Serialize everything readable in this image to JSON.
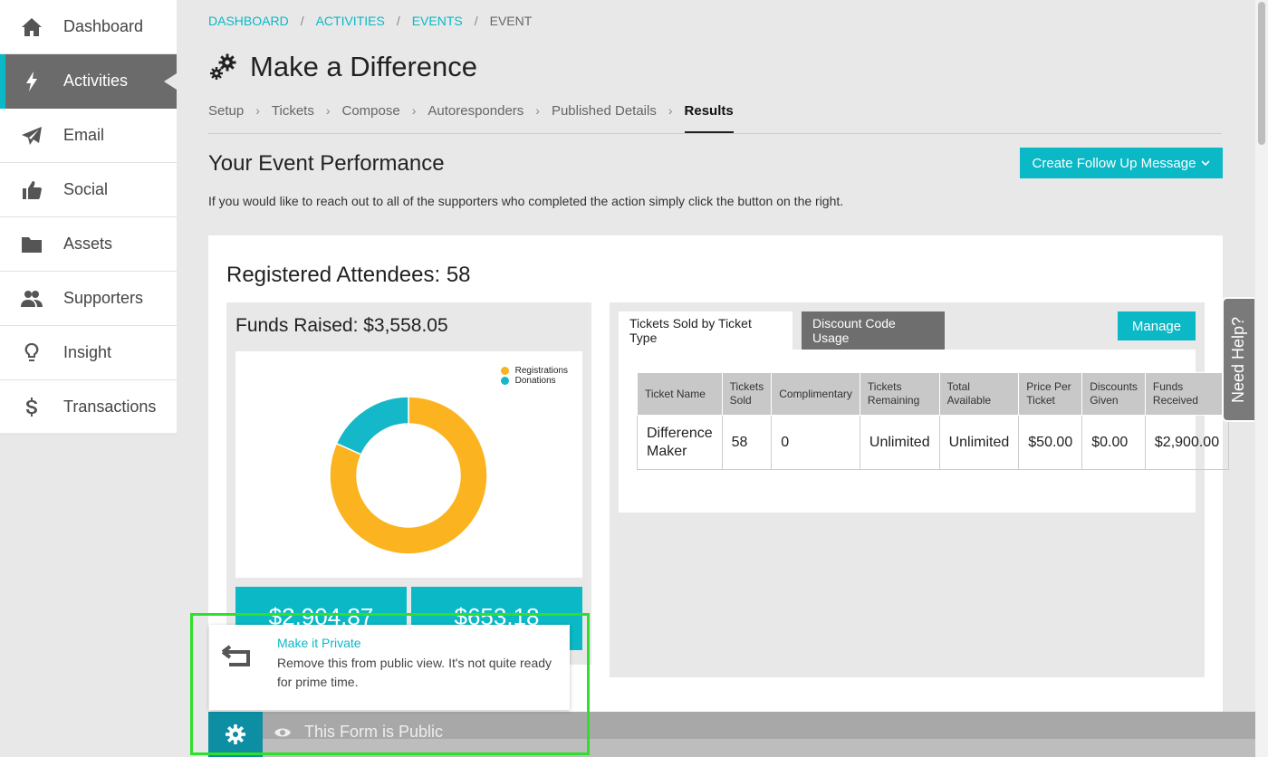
{
  "sidebar": {
    "items": [
      {
        "label": "Dashboard",
        "icon": "home-icon"
      },
      {
        "label": "Activities",
        "icon": "bolt-icon",
        "active": true
      },
      {
        "label": "Email",
        "icon": "paper-plane-icon"
      },
      {
        "label": "Social",
        "icon": "thumbs-up-icon"
      },
      {
        "label": "Assets",
        "icon": "folder-icon"
      },
      {
        "label": "Supporters",
        "icon": "users-icon"
      },
      {
        "label": "Insight",
        "icon": "lightbulb-icon"
      },
      {
        "label": "Transactions",
        "icon": "dollar-icon"
      }
    ]
  },
  "breadcrumb": [
    "DASHBOARD",
    "ACTIVITIES",
    "EVENTS",
    "EVENT"
  ],
  "page": {
    "title": "Make a Difference",
    "steps": [
      "Setup",
      "Tickets",
      "Compose",
      "Autoresponders",
      "Published Details",
      "Results"
    ],
    "active_step": "Results"
  },
  "performance": {
    "title": "Your Event Performance",
    "description": "If you would like to reach out to all of the supporters who completed the action simply click the button on the right.",
    "followup_button": "Create Follow Up Message"
  },
  "card": {
    "attendees_title": "Registered Attendees: 58",
    "funds_title": "Funds Raised: $3,558.05",
    "tiles": [
      "$2,904.87",
      "$653.18"
    ]
  },
  "chart_data": {
    "type": "pie",
    "donut": true,
    "categories": [
      "Registrations",
      "Donations"
    ],
    "values": [
      2904.87,
      653.18
    ],
    "colors": [
      "#fbb31f",
      "#14b8c9"
    ],
    "legend_position": "top-right"
  },
  "tickets": {
    "tabs": [
      "Tickets Sold by Ticket Type",
      "Discount Code Usage"
    ],
    "manage_label": "Manage",
    "columns": [
      "Ticket Name",
      "Tickets Sold",
      "Complimentary",
      "Tickets Remaining",
      "Total Available",
      "Price Per Ticket",
      "Discounts Given",
      "Funds Received"
    ],
    "rows": [
      [
        "Difference Maker",
        "58",
        "0",
        "Unlimited",
        "Unlimited",
        "$50.00",
        "$0.00",
        "$2,900.00"
      ]
    ]
  },
  "help": {
    "label": "Need Help?"
  },
  "popup": {
    "title": "Make it Private",
    "description": "Remove this from public view. It's not quite ready for prime time."
  },
  "status_bar": {
    "label": "This Form is Public"
  },
  "colors": {
    "accent": "#0ab8c6",
    "sidebar_active": "#6b6b6b"
  }
}
